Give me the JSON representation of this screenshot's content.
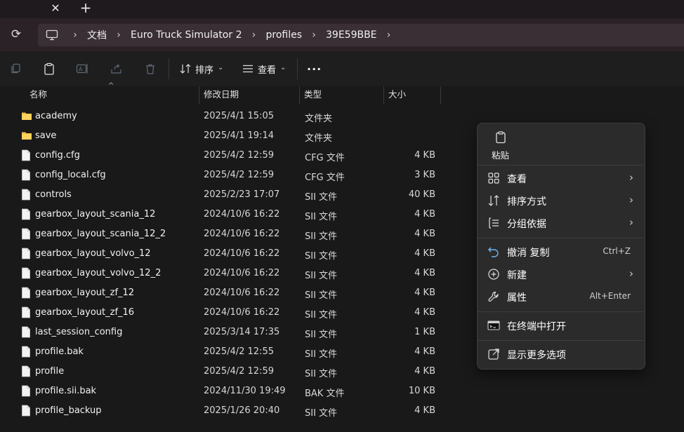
{
  "tabs": {
    "close_glyph": "✕",
    "new_glyph": "+"
  },
  "address": {
    "refresh_glyph": "⟳",
    "separator": "›",
    "crumbs": [
      "文档",
      "Euro Truck Simulator 2",
      "profiles",
      "39E59BBE"
    ]
  },
  "toolbar": {
    "sort_label": "排序",
    "view_label": "查看",
    "more_glyph": "···",
    "chevron": "⌄"
  },
  "columns": {
    "name": "名称",
    "date": "修改日期",
    "type": "类型",
    "size": "大小",
    "sort_glyph": "^"
  },
  "files": [
    {
      "name": "academy",
      "date": "2025/4/1 15:05",
      "type": "文件夹",
      "size": "",
      "icon": "folder-icon"
    },
    {
      "name": "save",
      "date": "2025/4/1 19:14",
      "type": "文件夹",
      "size": "",
      "icon": "folder-icon"
    },
    {
      "name": "config.cfg",
      "date": "2025/4/2 12:59",
      "type": "CFG 文件",
      "size": "4 KB",
      "icon": "file-icon"
    },
    {
      "name": "config_local.cfg",
      "date": "2025/4/2 12:59",
      "type": "CFG 文件",
      "size": "3 KB",
      "icon": "file-icon"
    },
    {
      "name": "controls",
      "date": "2025/2/23 17:07",
      "type": "SII 文件",
      "size": "40 KB",
      "icon": "file-icon"
    },
    {
      "name": "gearbox_layout_scania_12",
      "date": "2024/10/6 16:22",
      "type": "SII 文件",
      "size": "4 KB",
      "icon": "file-icon"
    },
    {
      "name": "gearbox_layout_scania_12_2",
      "date": "2024/10/6 16:22",
      "type": "SII 文件",
      "size": "4 KB",
      "icon": "file-icon"
    },
    {
      "name": "gearbox_layout_volvo_12",
      "date": "2024/10/6 16:22",
      "type": "SII 文件",
      "size": "4 KB",
      "icon": "file-icon"
    },
    {
      "name": "gearbox_layout_volvo_12_2",
      "date": "2024/10/6 16:22",
      "type": "SII 文件",
      "size": "4 KB",
      "icon": "file-icon"
    },
    {
      "name": "gearbox_layout_zf_12",
      "date": "2024/10/6 16:22",
      "type": "SII 文件",
      "size": "4 KB",
      "icon": "file-icon"
    },
    {
      "name": "gearbox_layout_zf_16",
      "date": "2024/10/6 16:22",
      "type": "SII 文件",
      "size": "4 KB",
      "icon": "file-icon"
    },
    {
      "name": "last_session_config",
      "date": "2025/3/14 17:35",
      "type": "SII 文件",
      "size": "1 KB",
      "icon": "file-icon"
    },
    {
      "name": "profile.bak",
      "date": "2025/4/2 12:55",
      "type": "SII 文件",
      "size": "4 KB",
      "icon": "file-icon"
    },
    {
      "name": "profile",
      "date": "2025/4/2 12:59",
      "type": "SII 文件",
      "size": "4 KB",
      "icon": "file-icon"
    },
    {
      "name": "profile.sii.bak",
      "date": "2024/11/30 19:49",
      "type": "BAK 文件",
      "size": "10 KB",
      "icon": "file-icon"
    },
    {
      "name": "profile_backup",
      "date": "2025/1/26 20:40",
      "type": "SII 文件",
      "size": "4 KB",
      "icon": "file-icon"
    }
  ],
  "context_menu": {
    "paste_label": "粘贴",
    "arrow_glyph": "›",
    "items": [
      {
        "id": "view",
        "label": "查看",
        "right": "",
        "submenu": true,
        "icon": "grid-icon"
      },
      {
        "id": "sort",
        "label": "排序方式",
        "right": "",
        "submenu": true,
        "icon": "sort-icon"
      },
      {
        "id": "group",
        "label": "分组依据",
        "right": "",
        "submenu": true,
        "icon": "list-icon"
      },
      {
        "id": "undo",
        "label": "撤消 复制",
        "right": "Ctrl+Z",
        "submenu": false,
        "icon": "undo-icon"
      },
      {
        "id": "new",
        "label": "新建",
        "right": "",
        "submenu": true,
        "icon": "plus-circle-icon"
      },
      {
        "id": "properties",
        "label": "属性",
        "right": "Alt+Enter",
        "submenu": false,
        "icon": "wrench-icon"
      },
      {
        "id": "terminal",
        "label": "在终端中打开",
        "right": "",
        "submenu": false,
        "icon": "terminal-icon"
      },
      {
        "id": "more",
        "label": "显示更多选项",
        "right": "",
        "submenu": false,
        "icon": "open-external-icon"
      }
    ]
  },
  "colors": {
    "folder": "#f4c04a",
    "accent": "#6fb3f0",
    "background": "#191919",
    "menu": "#2b2b2b"
  }
}
